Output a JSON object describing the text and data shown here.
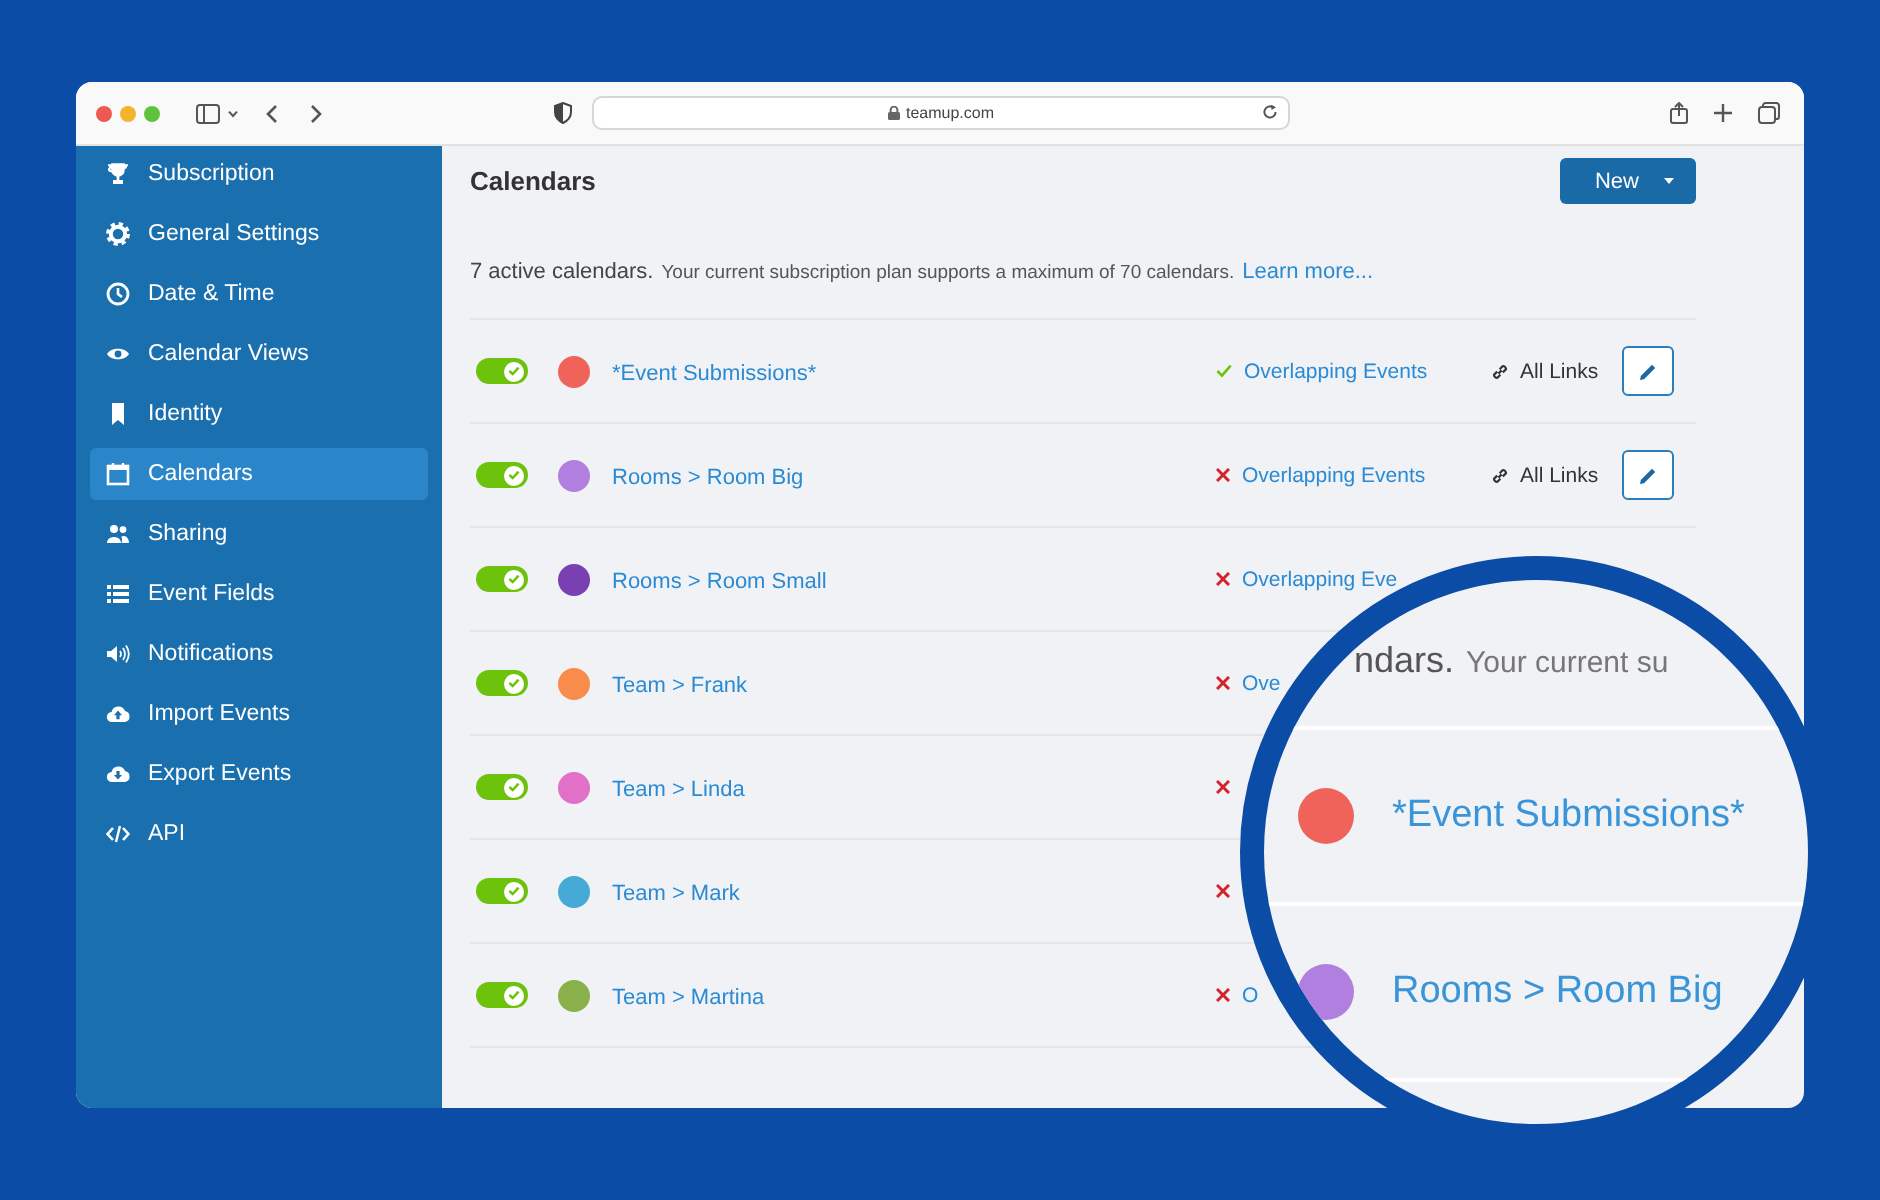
{
  "browser": {
    "url": "teamup.com"
  },
  "sidebar": {
    "items": [
      {
        "label": "Subscription",
        "selected": false
      },
      {
        "label": "General Settings",
        "selected": false
      },
      {
        "label": "Date & Time",
        "selected": false
      },
      {
        "label": "Calendar Views",
        "selected": false
      },
      {
        "label": "Identity",
        "selected": false
      },
      {
        "label": "Calendars",
        "selected": true
      },
      {
        "label": "Sharing",
        "selected": false
      },
      {
        "label": "Event Fields",
        "selected": false
      },
      {
        "label": "Notifications",
        "selected": false
      },
      {
        "label": "Import Events",
        "selected": false
      },
      {
        "label": "Export Events",
        "selected": false
      },
      {
        "label": "API",
        "selected": false
      }
    ]
  },
  "page": {
    "title": "Calendars",
    "new_button": "New",
    "summary": {
      "count": "7 active calendars.",
      "text": "Your current subscription plan supports a maximum of 70 calendars.",
      "link": "Learn more..."
    }
  },
  "calendars": [
    {
      "name": "*Event Submissions*",
      "color": "#f0635a",
      "on": true,
      "overlap_ok": true,
      "overlap_label": "Overlapping Events",
      "links_label": "All Links",
      "edit": true
    },
    {
      "name": "Rooms > Room Big",
      "color": "#b07fe0",
      "on": true,
      "overlap_ok": false,
      "overlap_label": "Overlapping Events",
      "links_label": "All Links",
      "edit": true
    },
    {
      "name": "Rooms > Room Small",
      "color": "#7a3fb0",
      "on": true,
      "overlap_ok": false,
      "overlap_label": "Overlapping Eve",
      "edit": false
    },
    {
      "name": "Team > Frank",
      "color": "#f98c4a",
      "on": true,
      "overlap_ok": false,
      "overlap_label": "Ove",
      "edit": false
    },
    {
      "name": "Team > Linda",
      "color": "#e070c8",
      "on": true,
      "overlap_ok": false,
      "edit": false
    },
    {
      "name": "Team > Mark",
      "color": "#45aad6",
      "on": true,
      "overlap_ok": false,
      "edit": false
    },
    {
      "name": "Team > Martina",
      "color": "#8ab04a",
      "on": true,
      "overlap_ok": false,
      "overlap_label": "O",
      "edit": false
    }
  ],
  "magnifier": {
    "title_fragment": "ndars.",
    "text_fragment": "Your current su",
    "rows": [
      {
        "name": "*Event Submissions*",
        "color": "#f0635a"
      },
      {
        "name": "Rooms > Room Big",
        "color": "#b07fe0"
      }
    ]
  }
}
